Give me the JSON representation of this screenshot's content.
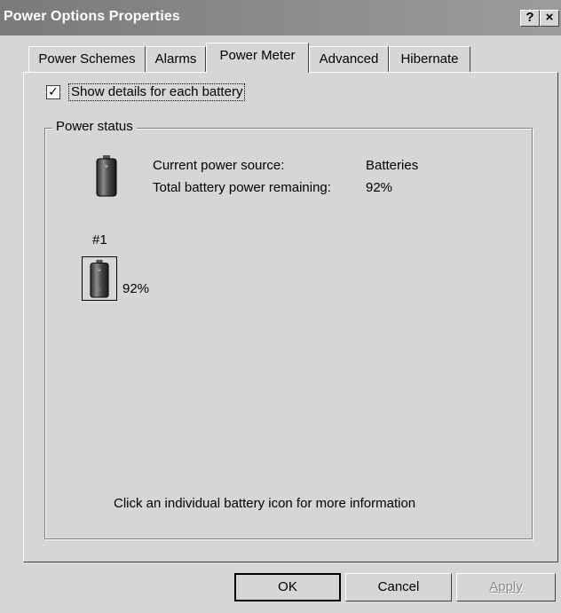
{
  "window": {
    "title": "Power Options Properties",
    "help_button": "?",
    "close_button": "×"
  },
  "tabs": [
    {
      "label": "Power Schemes",
      "active": false
    },
    {
      "label": "Alarms",
      "active": false
    },
    {
      "label": "Power Meter",
      "active": true
    },
    {
      "label": "Advanced",
      "active": false
    },
    {
      "label": "Hibernate",
      "active": false
    }
  ],
  "details_checkbox": {
    "label": "Show details for each battery",
    "checked": true
  },
  "power_status": {
    "group_label": "Power status",
    "current_source_label": "Current power source:",
    "current_source_value": "Batteries",
    "total_remaining_label": "Total battery power remaining:",
    "total_remaining_value": "92%"
  },
  "battery": {
    "label": "#1",
    "percent": "92%",
    "level": 0.92
  },
  "hint": "Click an individual battery icon for more information",
  "buttons": {
    "ok": "OK",
    "cancel": "Cancel",
    "apply": "Apply"
  },
  "colors": {
    "titlebar": "#7a7a7a",
    "face": "#d6d6d6"
  }
}
